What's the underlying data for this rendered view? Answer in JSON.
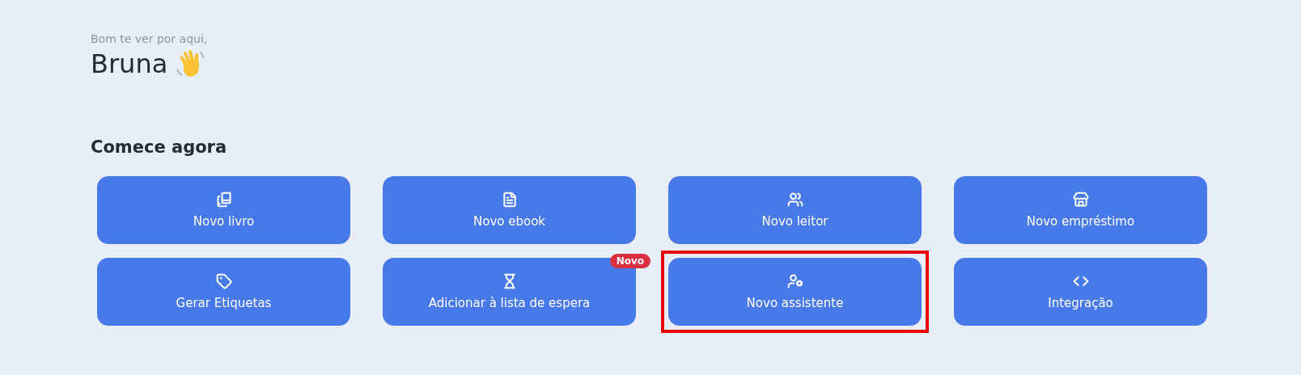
{
  "greeting": {
    "subtitle": "Bom te ver por aqui,",
    "name": "Bruna"
  },
  "section": {
    "title": "Comece agora"
  },
  "actions": [
    {
      "label": "Novo livro",
      "highlighted": false
    },
    {
      "label": "Novo ebook",
      "highlighted": false
    },
    {
      "label": "Novo leitor",
      "highlighted": false
    },
    {
      "label": "Novo empréstimo",
      "highlighted": false
    },
    {
      "label": "Gerar Etiquetas",
      "highlighted": false
    },
    {
      "label": "Adicionar à lista de espera",
      "badge": "Novo",
      "highlighted": false
    },
    {
      "label": "Novo assistente",
      "highlighted": true
    },
    {
      "label": "Integração",
      "highlighted": false
    }
  ]
}
